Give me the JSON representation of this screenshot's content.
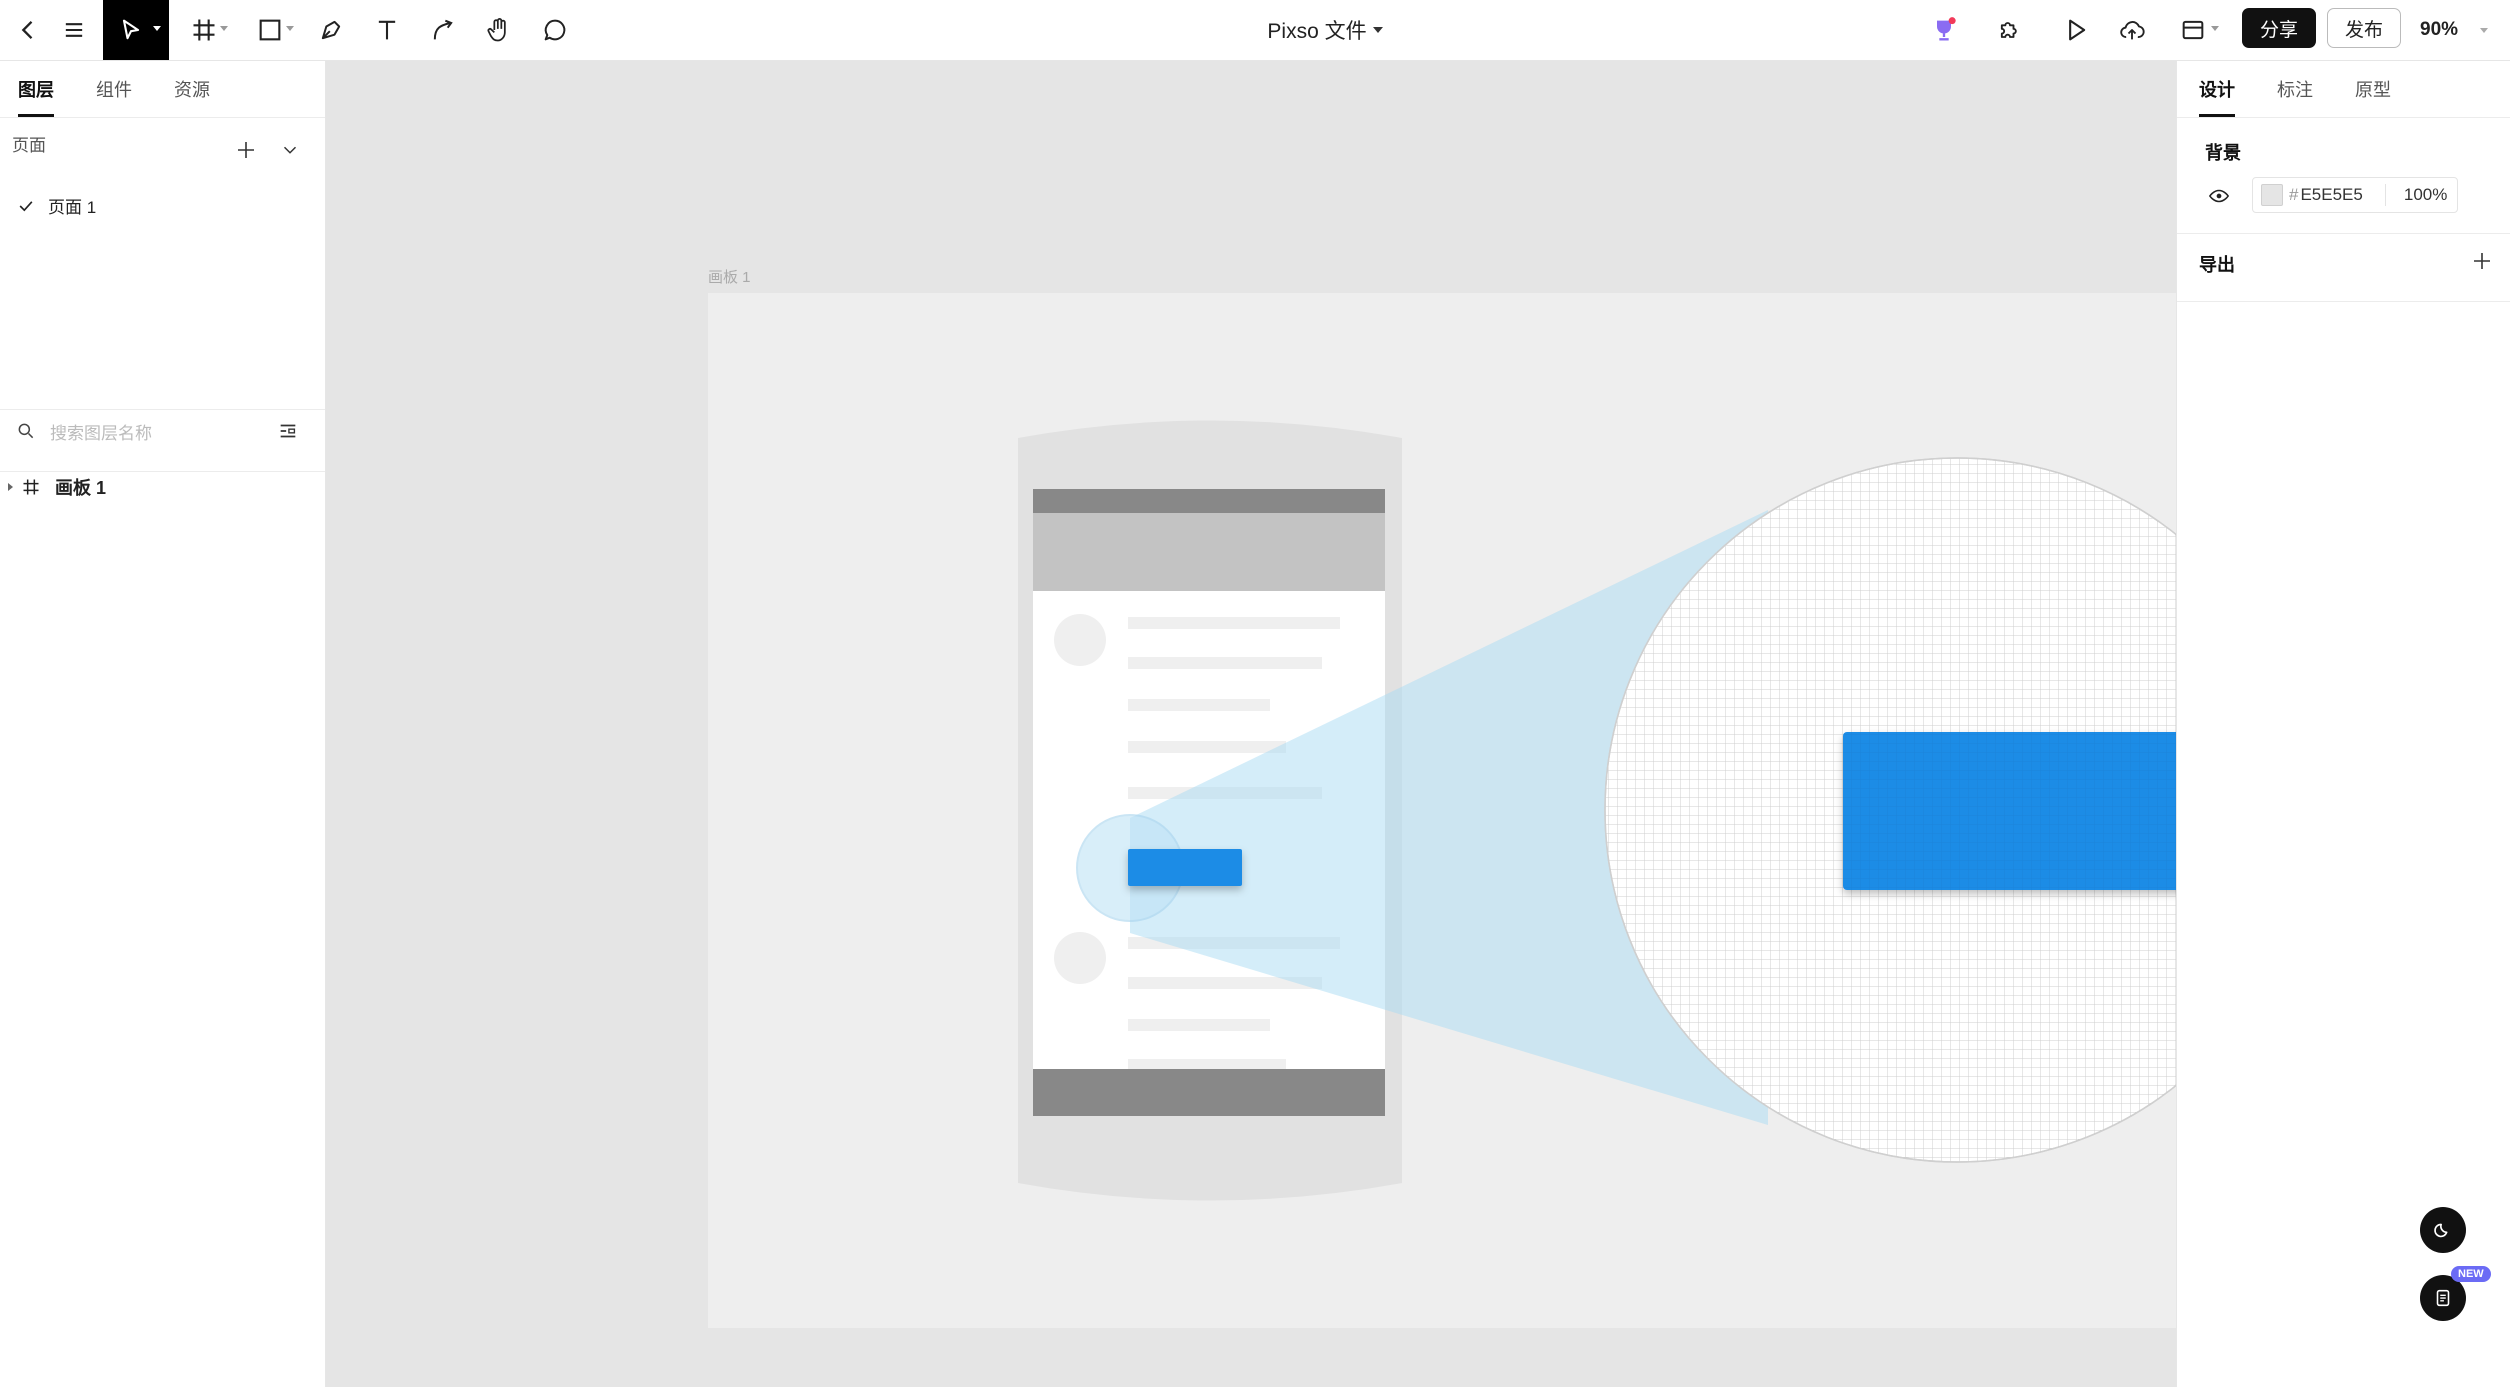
{
  "toolbar": {
    "back_icon": "chevron-left-icon",
    "menu_icon": "hamburger-menu-icon",
    "tools": [
      "move-tool",
      "frame-tool",
      "shape-tool",
      "pen-tool",
      "text-tool",
      "connector-tool",
      "hand-tool",
      "comment-tool"
    ],
    "file_title": "Pixso 文件",
    "share_label": "分享",
    "publish_label": "发布",
    "zoom": "90%"
  },
  "left_panel": {
    "tabs": [
      {
        "label": "图层",
        "active": true
      },
      {
        "label": "组件",
        "active": false
      },
      {
        "label": "资源",
        "active": false
      }
    ],
    "pages_heading": "页面",
    "pages": [
      {
        "label": "页面 1",
        "selected": true
      }
    ],
    "search_placeholder": "搜索图层名称",
    "layers": [
      {
        "label": "画板 1",
        "type": "frame"
      }
    ]
  },
  "right_panel": {
    "tabs": [
      {
        "label": "设计",
        "active": true
      },
      {
        "label": "标注",
        "active": false
      },
      {
        "label": "原型",
        "active": false
      }
    ],
    "background_title": "背景",
    "background_color": "E5E5E5",
    "background_hash": "#",
    "background_opacity": "100%",
    "export_title": "导出"
  },
  "canvas": {
    "frame_label": "画板 1",
    "frame_bg": "#eeeeee",
    "accent_button_color": "#1f8ce6"
  },
  "floating": {
    "theme_icon": "moon-icon",
    "doc_icon": "document-icon",
    "new_badge": "NEW"
  }
}
